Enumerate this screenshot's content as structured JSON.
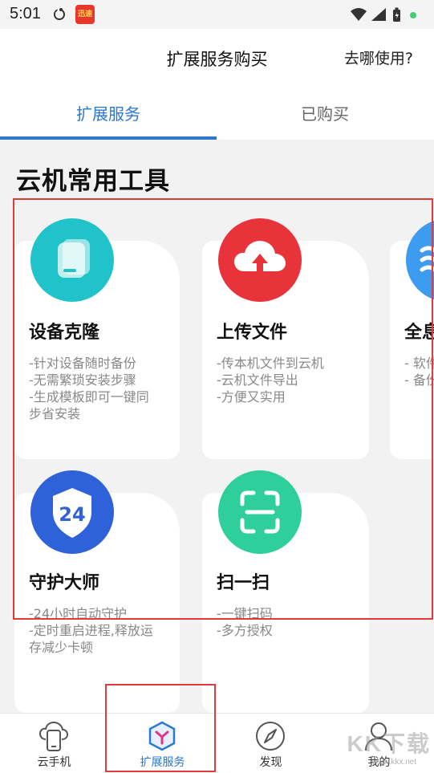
{
  "status_bar": {
    "time": "5:01",
    "icons": [
      "app-notification-icon",
      "app-badge-icon",
      "wifi-icon",
      "signal-icon",
      "battery-icon",
      "dot-icon"
    ],
    "badge_text": "迅速"
  },
  "header": {
    "title": "扩展服务购买",
    "help_link": "去哪使用?"
  },
  "tabs": [
    {
      "label": "扩展服务",
      "active": true
    },
    {
      "label": "已购买",
      "active": false
    }
  ],
  "section": {
    "title": "云机常用工具"
  },
  "cards": [
    {
      "title": "设备克隆",
      "icon": "device-clone-icon",
      "icon_color": "#1fc3c9",
      "desc": [
        "-针对设备随时备份",
        "-无需繁琐安装步骤",
        "-生成模板即可一键同",
        "步省安装"
      ]
    },
    {
      "title": "上传文件",
      "icon": "cloud-upload-icon",
      "icon_color": "#e8333a",
      "desc": [
        "-传本机文件到云机",
        "-云机文件导出",
        "-方便又实用"
      ]
    },
    {
      "title": "全息",
      "icon": "backup-icon",
      "icon_color": "#3d9cf0",
      "desc": [
        "- 软件",
        "- 备份"
      ]
    },
    {
      "title": "守护大师",
      "icon": "shield-24-icon",
      "icon_color": "#2f62d8",
      "desc": [
        "-24小时自动守护",
        "-定时重启进程,释放运",
        "存减少卡顿"
      ]
    },
    {
      "title": "扫一扫",
      "icon": "scan-icon",
      "icon_color": "#2ecf9b",
      "desc": [
        "-一键扫码",
        "-多方授权"
      ]
    }
  ],
  "bottom_nav": [
    {
      "label": "云手机",
      "icon": "cloud-phone-icon",
      "active": false
    },
    {
      "label": "扩展服务",
      "icon": "extension-cube-icon",
      "active": true
    },
    {
      "label": "发现",
      "icon": "compass-icon",
      "active": false
    },
    {
      "label": "我的",
      "icon": "profile-icon",
      "active": false
    }
  ],
  "watermark": {
    "text": "KK下载",
    "sub": "www.kkx.net"
  },
  "colors": {
    "accent": "#2a78d0",
    "highlight_box": "#e03a3a"
  }
}
